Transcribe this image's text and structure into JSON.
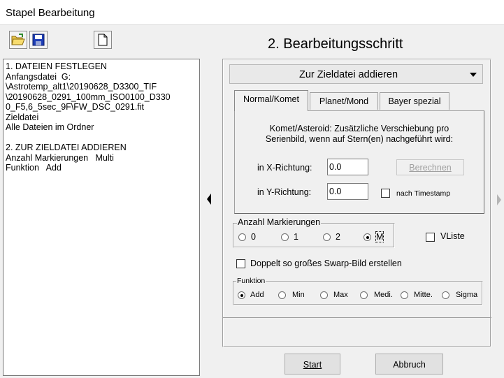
{
  "window": {
    "title": "Stapel Bearbeitung"
  },
  "toolbar": {
    "open_icon": "folder-open-icon",
    "save_icon": "floppy-disk-icon",
    "new_icon": "new-document-icon"
  },
  "log": {
    "text": "1. DATEIEN FESTLEGEN\nAnfangsdatei  G:\n\\Astrotemp_alt1\\20190628_D3300_TIF\n\\20190628_0291_100mm_ISO0100_D330\n0_F5,6_5sec_9F\\FW_DSC_0291.fit\nZieldatei\nAlle Dateien im Ordner\n\n2. ZUR ZIELDATEI ADDIEREN\nAnzahl Markierungen   Multi\nFunktion   Add"
  },
  "step": {
    "title": "2. Bearbeitungsschritt"
  },
  "operation": {
    "selected": "Zur Zieldatei addieren"
  },
  "tabs": [
    {
      "label": "Normal/Komet"
    },
    {
      "label": "Planet/Mond"
    },
    {
      "label": "Bayer spezial"
    }
  ],
  "komet": {
    "description_line1": "Komet/Asteroid:  Zusätzliche Verschiebung pro",
    "description_line2": "Serienbild, wenn auf Stern(en) nachgeführt wird:",
    "x_label": "in X-Richtung:",
    "x_value": "0.0",
    "y_label": "in Y-Richtung:",
    "y_value": "0.0",
    "compute_label": "Berechnen",
    "timestamp_label": "nach Timestamp"
  },
  "markierungen": {
    "legend": "Anzahl Markierungen",
    "options": [
      "0",
      "1",
      "2",
      "M"
    ],
    "selected": "M"
  },
  "vliste": {
    "label": "VListe"
  },
  "swarp": {
    "label": "Doppelt so großes Swarp-Bild erstellen"
  },
  "funktion": {
    "legend": "Funktion",
    "options": [
      "Add",
      "Min",
      "Max",
      "Medi.",
      "Mitte.",
      "Sigma"
    ],
    "selected": "Add"
  },
  "footer": {
    "start_label": "Start",
    "cancel_label": "Abbruch"
  }
}
